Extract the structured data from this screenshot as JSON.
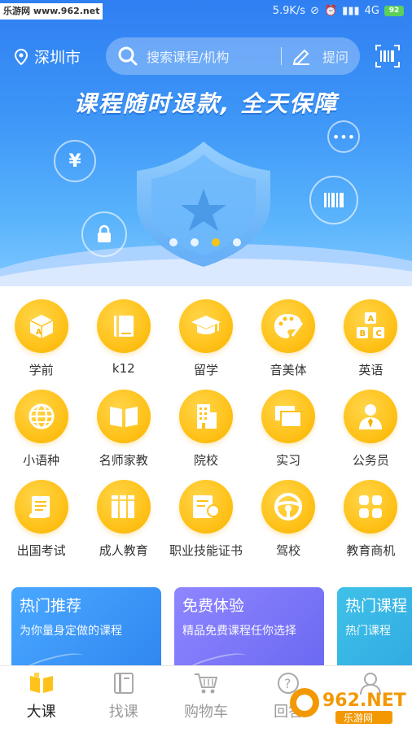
{
  "status_bar": {
    "site_badge": "乐游网 www.962.net",
    "speed": "5.9K/s",
    "network": "4G",
    "battery": "92"
  },
  "header": {
    "location": "深圳市",
    "search_placeholder": "搜索课程/机构",
    "ask_label": "提问"
  },
  "banner": {
    "slogan": "课程随时退款, 全天保障",
    "carousel_count": 4,
    "carousel_active_index": 2
  },
  "categories": [
    {
      "label": "学前",
      "icon": "cube-a-icon"
    },
    {
      "label": "k12",
      "icon": "book-icon"
    },
    {
      "label": "留学",
      "icon": "graduation-cap-icon"
    },
    {
      "label": "音美体",
      "icon": "palette-icon"
    },
    {
      "label": "英语",
      "icon": "abc-blocks-icon"
    },
    {
      "label": "小语种",
      "icon": "globe-icon"
    },
    {
      "label": "名师家教",
      "icon": "open-book-icon"
    },
    {
      "label": "院校",
      "icon": "building-icon"
    },
    {
      "label": "实习",
      "icon": "windows-icon"
    },
    {
      "label": "公务员",
      "icon": "person-tie-icon"
    },
    {
      "label": "出国考试",
      "icon": "scroll-icon"
    },
    {
      "label": "成人教育",
      "icon": "books-icon"
    },
    {
      "label": "职业技能证书",
      "icon": "certificate-icon"
    },
    {
      "label": "驾校",
      "icon": "steering-wheel-icon"
    },
    {
      "label": "教育商机",
      "icon": "grid-icon"
    }
  ],
  "promos": [
    {
      "title": "热门推荐",
      "subtitle": "为你量身定做的课程",
      "color_from": "#4aa8ff",
      "color_to": "#2f86f0"
    },
    {
      "title": "免费体验",
      "subtitle": "精品免费课程任你选择",
      "color_from": "#8f86ff",
      "color_to": "#6a68f2"
    },
    {
      "title": "热门课程",
      "subtitle": "热门课程",
      "color_from": "#3fc1e8",
      "color_to": "#2aa0e0"
    }
  ],
  "bottom_nav": [
    {
      "label": "大课",
      "icon": "books-nav-icon",
      "active": true
    },
    {
      "label": "找课",
      "icon": "find-course-icon",
      "active": false
    },
    {
      "label": "购物车",
      "icon": "cart-icon",
      "active": false
    },
    {
      "label": "回答",
      "icon": "question-icon",
      "active": false
    },
    {
      "label": "",
      "icon": "user-icon",
      "active": false
    }
  ],
  "watermark": {
    "brand": "962.NET",
    "sub": "乐游网"
  },
  "colors": {
    "accent_yellow": "#ffc21a",
    "banner_blue": "#3d95f7"
  }
}
